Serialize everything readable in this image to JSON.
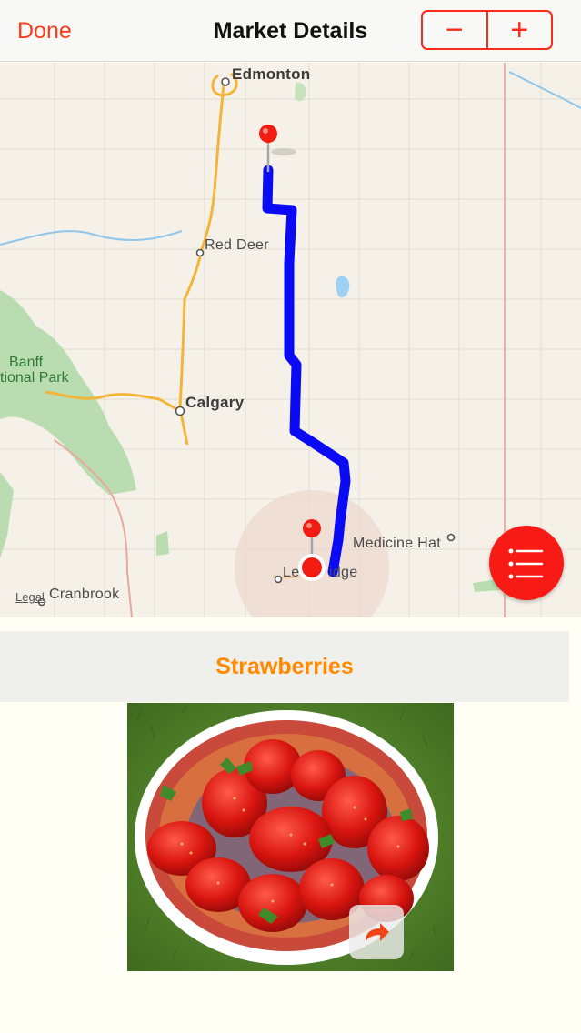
{
  "navbar": {
    "done_label": "Done",
    "title": "Market Details",
    "stepper": {
      "minus": "−",
      "plus": "+"
    }
  },
  "map": {
    "cities": {
      "edmonton": "Edmonton",
      "red_deer": "Red Deer",
      "calgary": "Calgary",
      "medicine_hat": "Medicine Hat",
      "lethbridge": "Le",
      "lethbridge_tail": "idge",
      "cranbrook": "Cranbrook"
    },
    "park_line1": "Banff",
    "park_line2": "tional Park",
    "legal": "Legal",
    "route_color": "#0a0af5",
    "pin_color": "#f21c12"
  },
  "list_button_icon": "list-icon",
  "product": {
    "title": "Strawberries",
    "title_color": "#ff8a00"
  },
  "photo": {
    "share_icon": "share-arrow-icon"
  }
}
